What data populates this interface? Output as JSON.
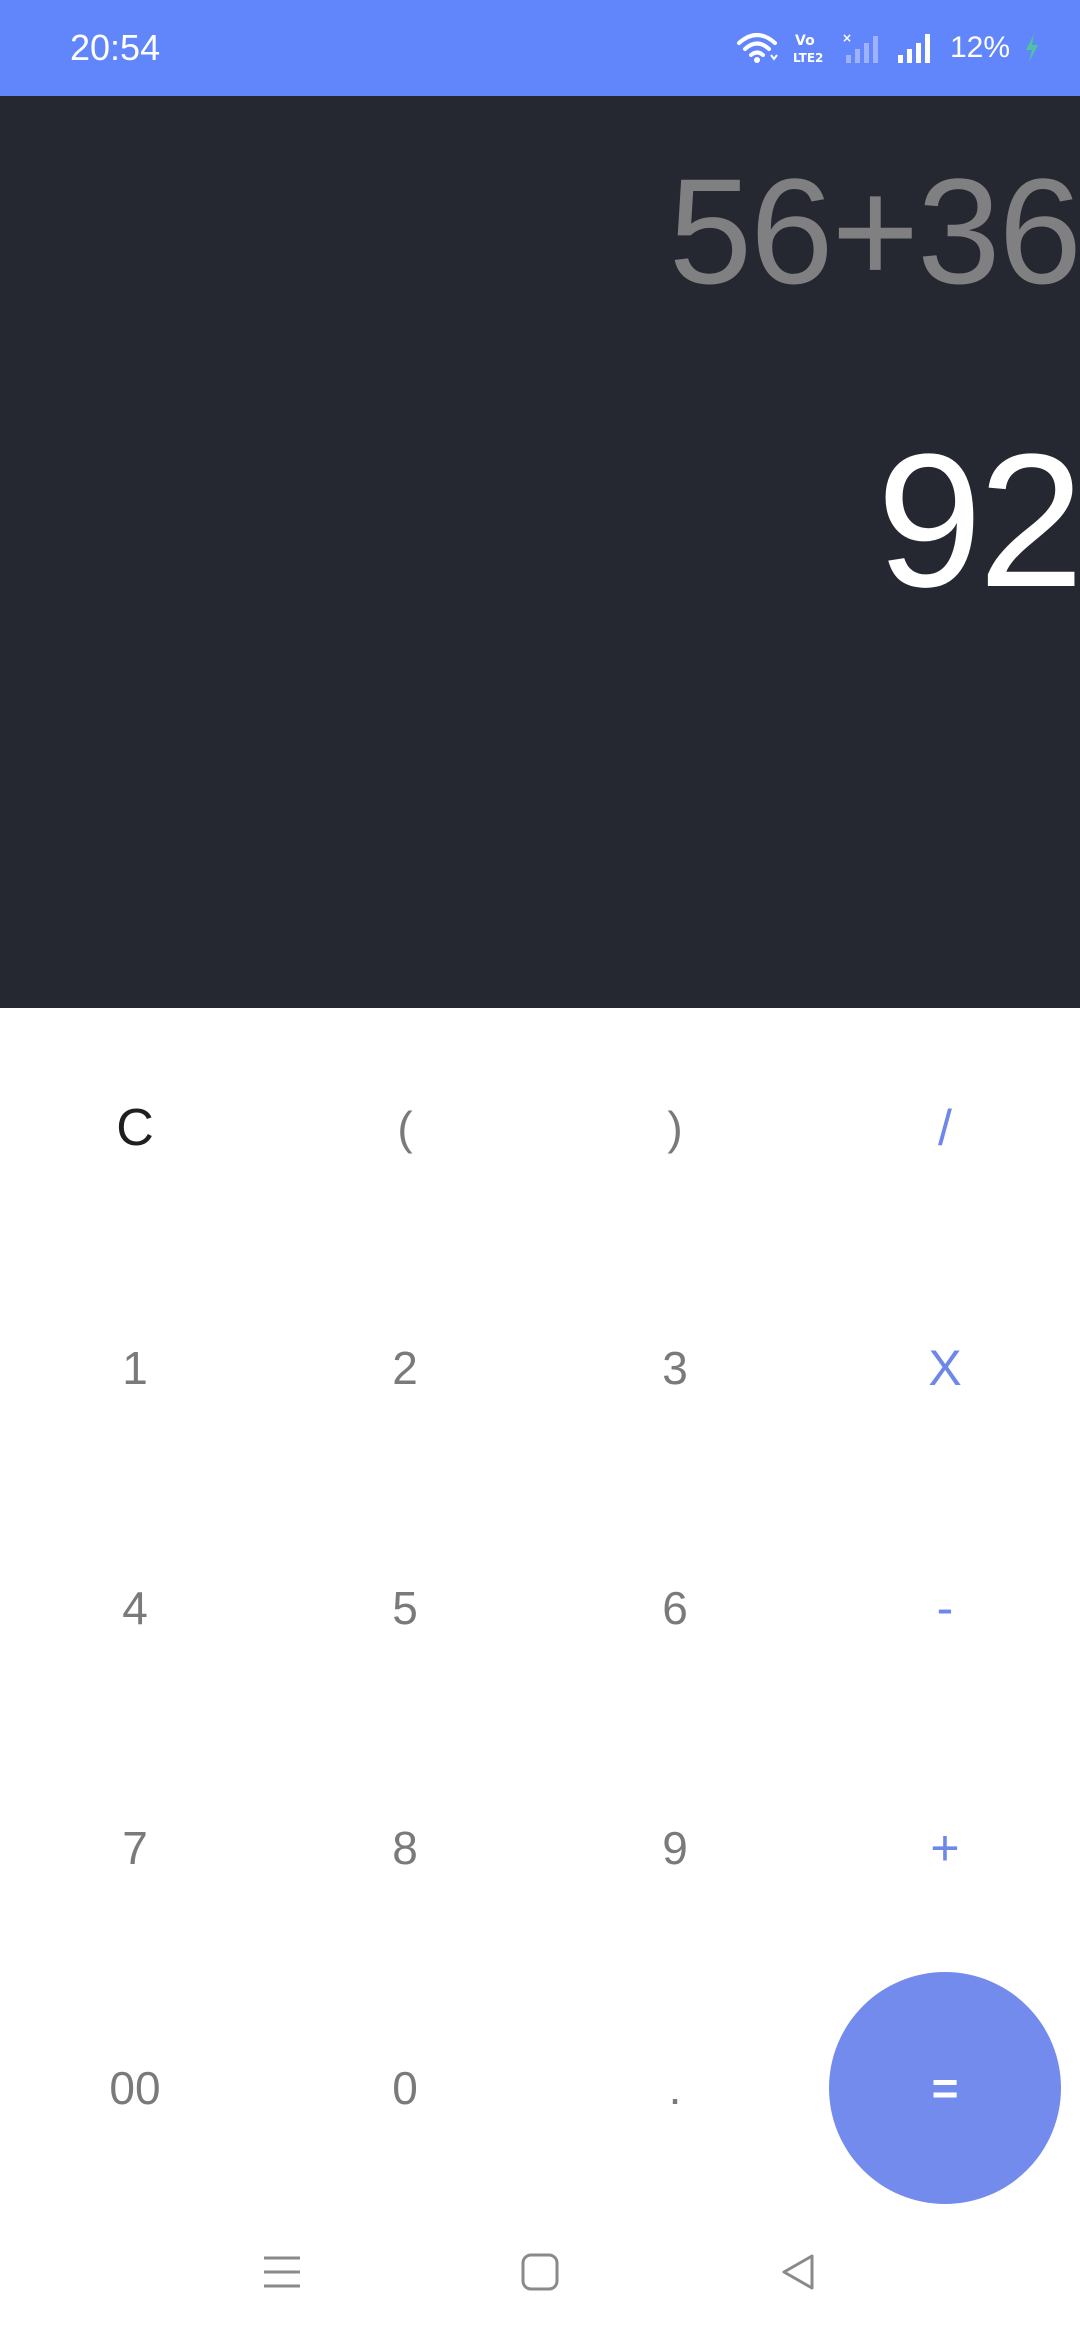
{
  "status_bar": {
    "time": "20:54",
    "battery": "12%",
    "icons": [
      "wifi-icon",
      "volte-icon",
      "sim1-no-signal-icon",
      "sim2-signal-icon",
      "battery-charging-icon"
    ]
  },
  "display": {
    "expression": "56+36",
    "result": "92"
  },
  "keypad": {
    "rows": [
      [
        "C",
        "(",
        ")",
        "/"
      ],
      [
        "1",
        "2",
        "3",
        "X"
      ],
      [
        "4",
        "5",
        "6",
        "-"
      ],
      [
        "7",
        "8",
        "9",
        "+"
      ],
      [
        "00",
        "0",
        ".",
        "="
      ]
    ]
  },
  "navbar": {
    "icons": [
      "recent-apps-icon",
      "home-icon",
      "back-icon"
    ]
  },
  "colors": {
    "status_bar": "#6185fb",
    "display_bg": "#252830",
    "accent": "#728bed",
    "operator": "#6e88ea"
  }
}
